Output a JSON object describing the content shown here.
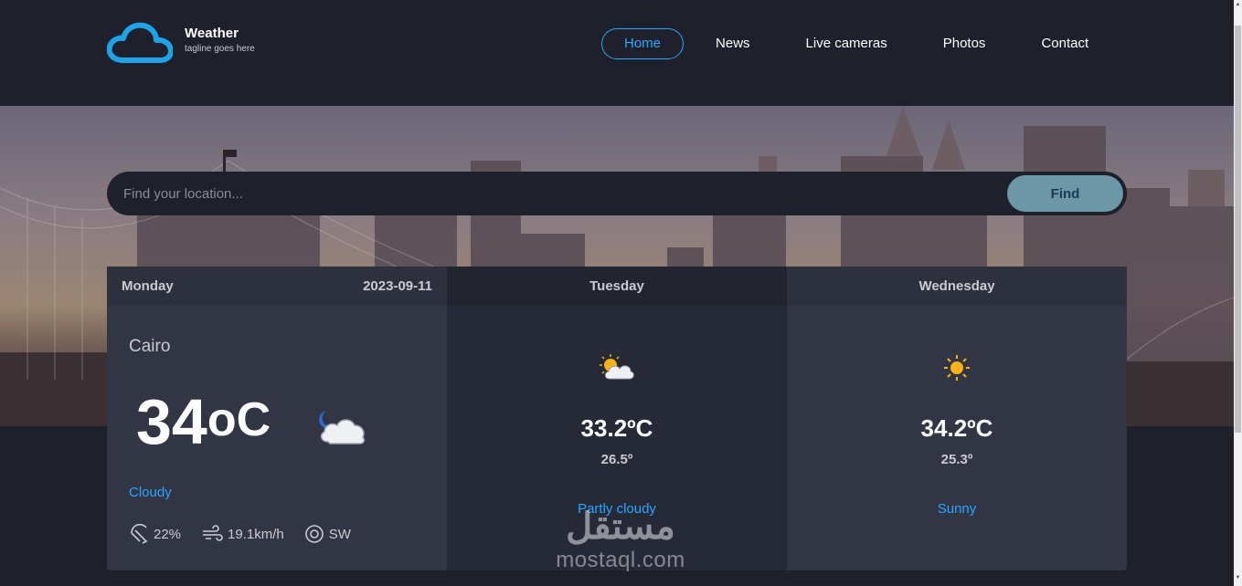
{
  "brand": {
    "title": "Weather",
    "tagline": "tagline goes here",
    "logo_icon": "cloud-icon",
    "accent": "#1ea3e8"
  },
  "nav": {
    "items": [
      {
        "label": "Home",
        "active": true
      },
      {
        "label": "News",
        "active": false
      },
      {
        "label": "Live cameras",
        "active": false
      },
      {
        "label": "Photos",
        "active": false
      },
      {
        "label": "Contact",
        "active": false
      }
    ]
  },
  "search": {
    "placeholder": "Find your location...",
    "button_label": "Find"
  },
  "today": {
    "day": "Monday",
    "date": "2023-09-11",
    "city": "Cairo",
    "temp": "34",
    "unit": "oC",
    "condition": "Cloudy",
    "icon": "partly-cloudy-night-icon",
    "humidity": "22%",
    "wind_speed": "19.1km/h",
    "wind_direction": "SW"
  },
  "forecast": [
    {
      "day": "Tuesday",
      "max": "33.2ºC",
      "min": "26.5º",
      "condition": "Partly cloudy",
      "icon": "partly-cloudy-icon"
    },
    {
      "day": "Wednesday",
      "max": "34.2ºC",
      "min": "25.3º",
      "condition": "Sunny",
      "icon": "sun-icon"
    }
  ],
  "watermark": {
    "logo": "مستقل",
    "text": "mostaql.com"
  },
  "colors": {
    "background": "#1e202b",
    "card": "#323544",
    "card_alt": "#262936",
    "accent": "#2ba6ff",
    "button": "#6b97a6"
  }
}
